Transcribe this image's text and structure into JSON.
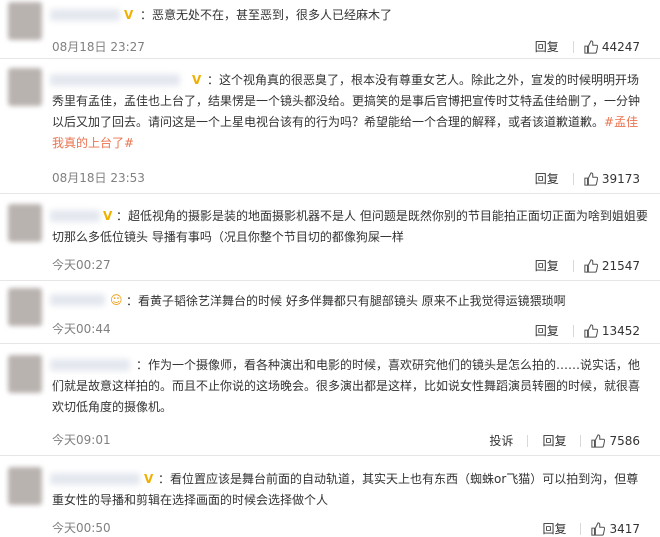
{
  "comments": [
    {
      "text": "：恶意无处不在，甚至恶到，很多人已经麻木了",
      "time": "08月18日 23:27",
      "reply": "回复",
      "likes": "44247"
    },
    {
      "text": "：这个视角真的很恶臭了，根本没有尊重女艺人。除此之外，宣发的时候明明开场秀里有孟佳，孟佳也上台了，结果愣是一个镜头都没给。更搞笑的是事后官博把宣传时艾特孟佳给删了，一分钟以后又加了回去。请问这是一个上星电视台该有的行为吗？希望能给一个合理的解释，或者该道歉道歉。",
      "tag": "#孟佳 我真的上台了#",
      "time": "08月18日 23:53",
      "reply": "回复",
      "likes": "39173"
    },
    {
      "text": "：超低视角的摄影是装的地面摄影机器不是人 但问题是既然你别的节目能拍正面切正面为啥到姐姐要切那么多低位镜头 导播有事吗（况且你整个节目切的都像狗屎一样",
      "time": "今天00:27",
      "reply": "回复",
      "likes": "21547"
    },
    {
      "text": "：看黄子韬徐艺洋舞台的时候 好多伴舞都只有腿部镜头 原来不止我觉得运镜猥琐啊",
      "time": "今天00:44",
      "reply": "回复",
      "likes": "13452"
    },
    {
      "text": "：作为一个摄像师，看各种演出和电影的时候，喜欢研究他们的镜头是怎么拍的……说实话，他们就是故意这样拍的。而且不止你说的这场晚会。很多演出都是这样，比如说女性舞蹈演员转圈的时候，就很喜欢切低角度的摄像机。",
      "time": "今天09:01",
      "report": "投诉",
      "reply": "回复",
      "likes": "7586"
    },
    {
      "text": "：看位置应该是舞台前面的自动轨道，其实天上也有东西（蜘蛛or飞猫）可以拍到沟，但尊重女性的导播和剪辑在选择画面的时候会选择做个人",
      "time": "今天00:50",
      "reply": "回复",
      "likes": "3417"
    }
  ],
  "icons": {
    "like": "thumbs-up-icon",
    "vip": "vip-v-badge-icon"
  },
  "colors": {
    "text": "#333333",
    "meta": "#808080",
    "tag": "#eb7350",
    "vip": "#f0b000"
  }
}
